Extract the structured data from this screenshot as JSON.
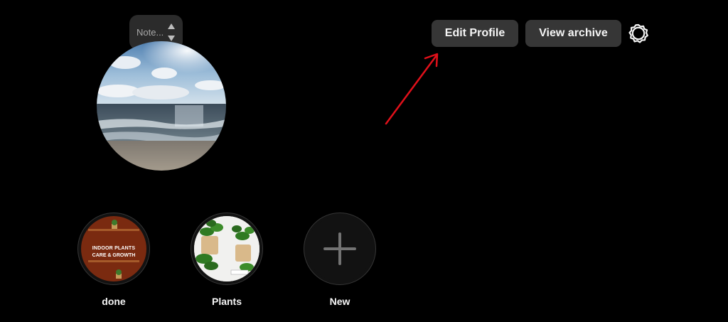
{
  "note": {
    "placeholder_text": "Note..."
  },
  "profile": {
    "edit_profile_label": "Edit Profile",
    "view_archive_label": "View archive",
    "settings_icon": "gear-icon",
    "annotation_color": "#e0101a"
  },
  "highlights": [
    {
      "label": "done",
      "cover_title": "INDOOR PLANTS",
      "cover_subtitle": "CARE & GROWTH"
    },
    {
      "label": "Plants"
    },
    {
      "label": "New",
      "icon": "plus-icon"
    }
  ]
}
